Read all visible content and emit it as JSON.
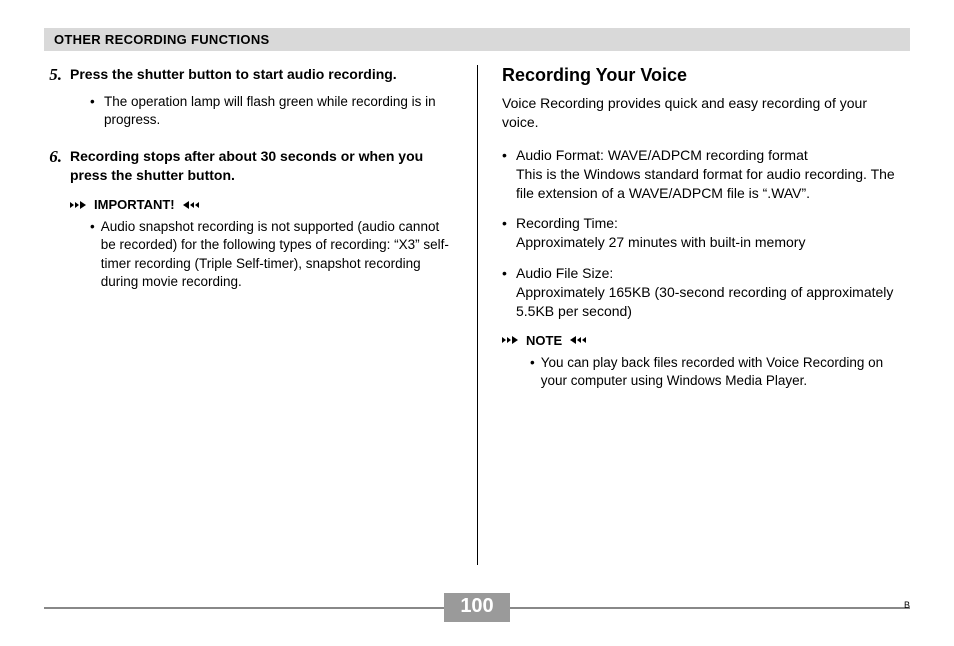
{
  "header": {
    "title": "OTHER RECORDING FUNCTIONS"
  },
  "left_column": {
    "steps": [
      {
        "num": "5",
        "text": "Press the shutter button to start audio recording.",
        "bullets": [
          "The operation lamp will flash green while recording is in progress."
        ]
      },
      {
        "num": "6",
        "text": "Recording stops after about 30 seconds or when you press the shutter button.",
        "bullets": []
      }
    ],
    "important": {
      "label": "IMPORTANT!",
      "bullets": [
        "Audio snapshot recording is not supported (audio cannot be recorded) for the following types of recording: “X3” self-timer recording (Triple Self-timer), snapshot recording during movie recording."
      ]
    }
  },
  "right_column": {
    "title": "Recording Your Voice",
    "intro": "Voice Recording provides quick and easy recording of your voice.",
    "specs": [
      "Audio Format: WAVE/ADPCM recording format\nThis is the Windows standard format for audio recording. The file extension of a WAVE/ADPCM file is “.WAV”.",
      "Recording Time:\nApproximately 27 minutes with built-in memory",
      "Audio File Size:\nApproximately 165KB (30-second recording of approximately 5.5KB per second)"
    ],
    "note": {
      "label": "NOTE",
      "bullets": [
        "You can play back files recorded with Voice Recording on your computer using Windows Media Player."
      ]
    }
  },
  "footer": {
    "page_number": "100",
    "corner_mark": "B"
  }
}
